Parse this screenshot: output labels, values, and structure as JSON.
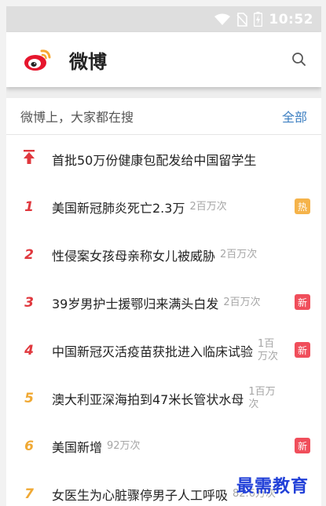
{
  "status_bar": {
    "time": "10:52"
  },
  "header": {
    "app_name": "微博"
  },
  "section": {
    "title": "微博上，大家都在搜",
    "all_label": "全部"
  },
  "colors": {
    "rank_red": "#e0383e",
    "rank_orange": "#f0a934",
    "hot_badge": "#f5b34a",
    "new_badge": "#f04e5b",
    "link_blue": "#3d7fc1"
  },
  "items": [
    {
      "rank": "",
      "icon": "pin-top-icon",
      "title": "首批50万份健康包配发给中国留学生",
      "count": "",
      "badge": ""
    },
    {
      "rank": "1",
      "title": "美国新冠肺炎死亡2.3万",
      "count": "2百万次",
      "badge": "热"
    },
    {
      "rank": "2",
      "title": "性侵案女孩母亲称女儿被威胁",
      "count": "2百万次",
      "badge": ""
    },
    {
      "rank": "3",
      "title": "39岁男护士援鄂归来满头白发",
      "count": "2百万次",
      "badge": "新"
    },
    {
      "rank": "4",
      "title": "中国新冠灭活疫苗获批进入临床试验",
      "count": "1百万次",
      "badge": "新"
    },
    {
      "rank": "5",
      "title": "澳大利亚深海拍到47米长管状水母",
      "count": "1百万次",
      "badge": ""
    },
    {
      "rank": "6",
      "title": "美国新增",
      "count": "92万次",
      "badge": "新"
    },
    {
      "rank": "7",
      "title": "女医生为心脏骤停男子人工呼吸",
      "count": "82.6万次",
      "badge": ""
    }
  ],
  "watermark": "最需教育"
}
